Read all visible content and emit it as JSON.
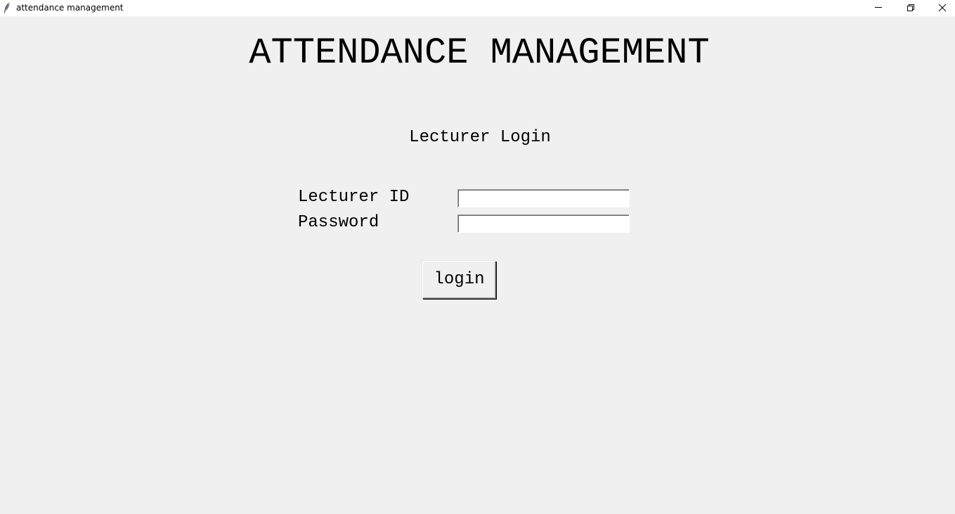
{
  "window": {
    "title": "attendance management",
    "controls": {
      "minimize": "minimize-icon",
      "maximize": "restore-icon",
      "close": "close-icon"
    },
    "app_icon": "feather-icon"
  },
  "main": {
    "heading": "ATTENDANCE MANAGEMENT",
    "subheading": "Lecturer Login",
    "form": {
      "lecturer_id_label": "Lecturer ID",
      "lecturer_id_value": "",
      "password_label": "Password",
      "password_value": "",
      "login_label": "login"
    }
  },
  "colors": {
    "background": "#f0f0f0",
    "titlebar": "#ffffff",
    "text": "#000000",
    "entry_background": "#ffffff"
  }
}
